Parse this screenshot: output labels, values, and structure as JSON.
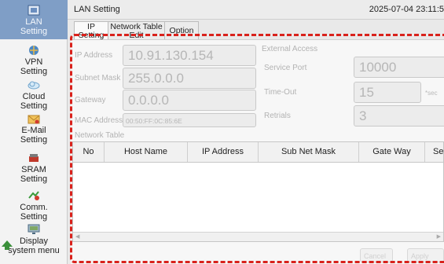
{
  "header": {
    "title": "LAN Setting",
    "datetime": "2025-07-04 23:11:5"
  },
  "sidebar": {
    "items": [
      {
        "label": "LAN\nSetting",
        "icon": "lan-icon"
      },
      {
        "label": "VPN\nSetting",
        "icon": "vpn-icon"
      },
      {
        "label": "Cloud\nSetting",
        "icon": "cloud-icon"
      },
      {
        "label": "E-Mail\nSetting",
        "icon": "email-icon"
      },
      {
        "label": "SRAM\nSetting",
        "icon": "sram-icon"
      },
      {
        "label": "Comm.\nSetting",
        "icon": "comm-icon"
      },
      {
        "label": "Display\nsystem menu",
        "icon": "display-icon"
      }
    ]
  },
  "tabs": [
    {
      "label": "IP\nSetting"
    },
    {
      "label": "Network Table\nEdit"
    },
    {
      "label": "Option"
    }
  ],
  "ip_section": {
    "ip_address_label": "IP Address",
    "ip_address": "10.91.130.154",
    "subnet_mask_label": "Subnet Mask",
    "subnet_mask": "255.0.0.0",
    "gateway_label": "Gateway",
    "gateway": "0.0.0.0",
    "mac_address_label": "MAC Address",
    "mac_address": "00:50:FF:0C:85:6E"
  },
  "external_access": {
    "title": "External Access",
    "service_port_label": "Service Port",
    "service_port": "10000",
    "timeout_label": "Time-Out",
    "timeout": "15",
    "timeout_unit": "*sec",
    "retrials_label": "Retrials",
    "retrials": "3"
  },
  "network_table": {
    "title": "Network Table",
    "columns": [
      "No",
      "Host Name",
      "IP Address",
      "Sub Net Mask",
      "Gate Way",
      "Se"
    ]
  },
  "buttons": {
    "cancel": "Cancel",
    "apply": "Apply"
  },
  "colors": {
    "highlight_border": "#d9221c",
    "active_sidebar": "#7f9ec6"
  }
}
